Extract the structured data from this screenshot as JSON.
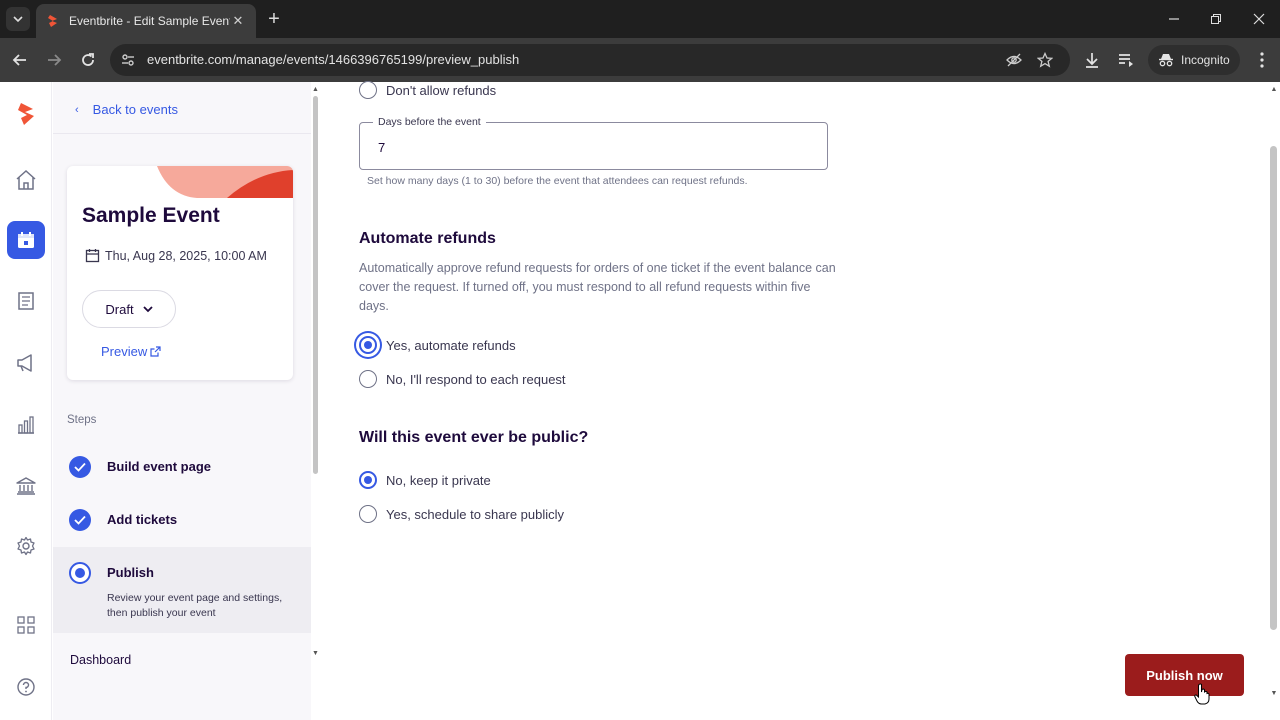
{
  "browser": {
    "tab_title": "Eventbrite - Edit Sample Event",
    "url": "eventbrite.com/manage/events/1466396765199/preview_publish",
    "incognito_label": "Incognito"
  },
  "rail": {
    "items": [
      "home-icon",
      "calendar-icon",
      "orders-icon",
      "megaphone-icon",
      "reports-icon",
      "finance-icon",
      "settings-icon",
      "apps-icon",
      "help-icon"
    ],
    "active": "calendar-icon",
    "brand_color": "#f05537",
    "accent": "#3659e3"
  },
  "sidebar": {
    "back_label": "Back to events",
    "event": {
      "title": "Sample Event",
      "date": "Thu, Aug 28, 2025, 10:00 AM",
      "status": "Draft",
      "preview_label": "Preview"
    },
    "steps_label": "Steps",
    "steps": [
      {
        "title": "Build event page",
        "state": "done"
      },
      {
        "title": "Add tickets",
        "state": "done"
      },
      {
        "title": "Publish",
        "state": "current",
        "description": "Review your event page and settings, then publish your event"
      }
    ],
    "dashboard_label": "Dashboard"
  },
  "main": {
    "dont_allow_refunds": "Don't allow refunds",
    "days_field": {
      "label": "Days before the event",
      "value": "7",
      "help": "Set how many days (1 to 30) before the event that attendees can request refunds."
    },
    "automate": {
      "title": "Automate refunds",
      "description": "Automatically approve refund requests for orders of one ticket if the event balance can cover the request. If turned off, you must respond to all refund requests within five days.",
      "options": [
        "Yes, automate refunds",
        "No, I'll respond to each request"
      ],
      "selected": 0
    },
    "public": {
      "title": "Will this event ever be public?",
      "options": [
        "No, keep it private",
        "Yes, schedule to share publicly"
      ],
      "selected": 0
    },
    "publish_label": "Publish now",
    "publish_color": "#9b1c1c"
  }
}
